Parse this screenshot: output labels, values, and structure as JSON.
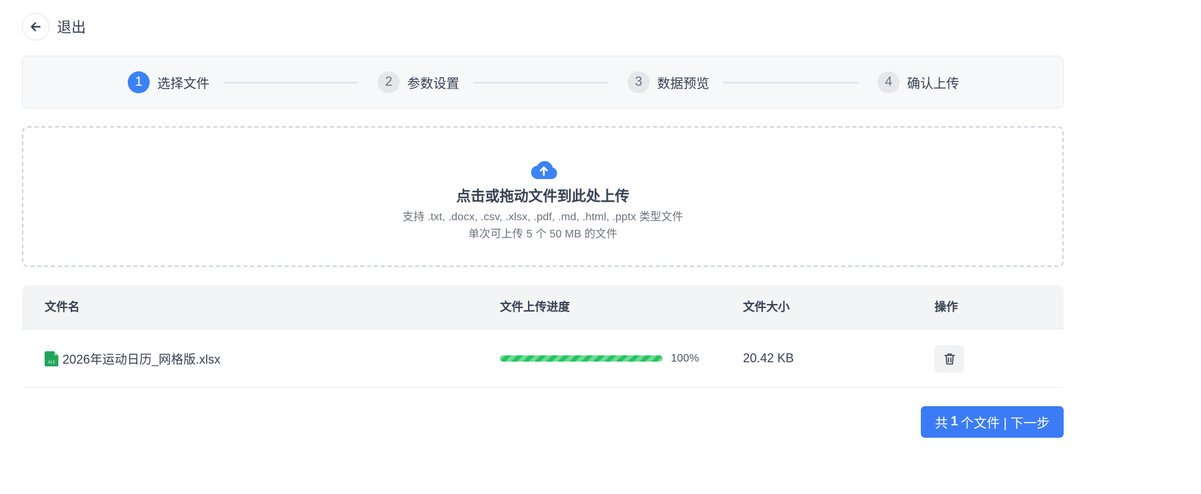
{
  "header": {
    "back_label": "退出"
  },
  "steps": [
    {
      "num": "1",
      "label": "选择文件",
      "active": true
    },
    {
      "num": "2",
      "label": "参数设置",
      "active": false
    },
    {
      "num": "3",
      "label": "数据预览",
      "active": false
    },
    {
      "num": "4",
      "label": "确认上传",
      "active": false
    }
  ],
  "upload": {
    "title": "点击或拖动文件到此处上传",
    "supported": "支持 .txt, .docx, .csv, .xlsx, .pdf, .md, .html, .pptx 类型文件",
    "limit": "单次可上传 5 个 50 MB 的文件"
  },
  "table": {
    "headers": {
      "name": "文件名",
      "progress": "文件上传进度",
      "size": "文件大小",
      "actions": "操作"
    },
    "rows": [
      {
        "name": "2026年运动日历_网格版.xlsx",
        "progress": 100,
        "progress_label": "100%",
        "size": "20.42 KB"
      }
    ]
  },
  "footer": {
    "prefix": "共",
    "count": "1",
    "suffix": "个文件 | 下一步"
  },
  "colors": {
    "primary": "#3b82f6",
    "success": "#22c55e",
    "muted": "#e5e7eb"
  }
}
